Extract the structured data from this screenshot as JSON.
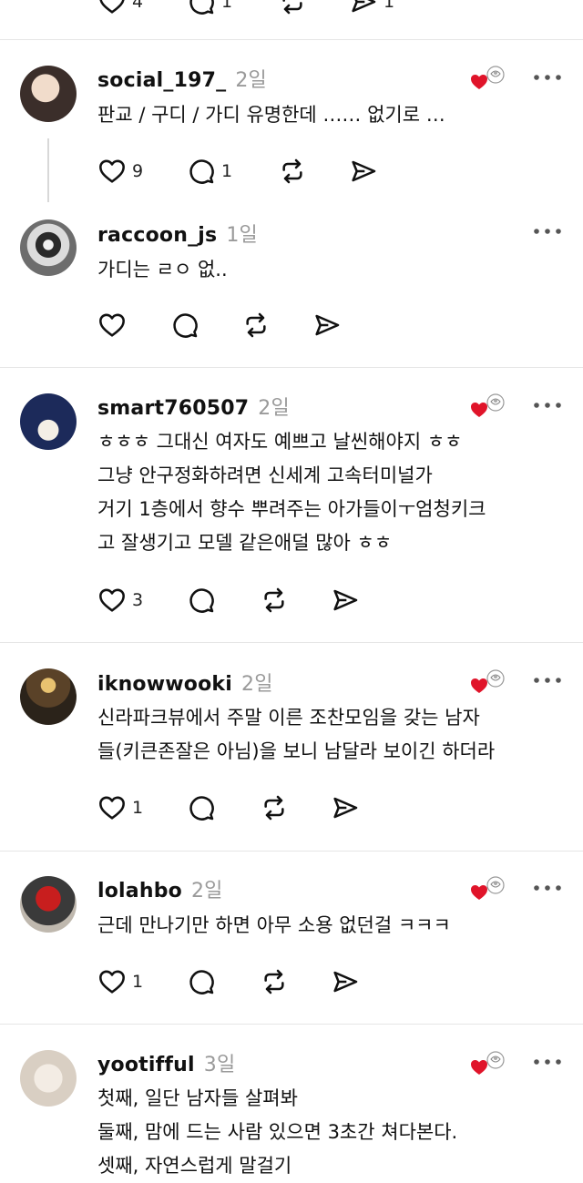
{
  "top_stats": {
    "likes": "4",
    "replies": "1",
    "reposts": "",
    "shares": "1"
  },
  "posts": [
    {
      "username": "social_197_",
      "time": "2일",
      "liked_by_author": true,
      "lines": [
        "판교 / 구디 / 가디 유명한데 …… 없기로 …"
      ],
      "likes": "9",
      "replies": "1"
    },
    {
      "username": "raccoon_js",
      "time": "1일",
      "liked_by_author": false,
      "lines": [
        "가디는 ㄹㅇ 없.."
      ],
      "likes": "",
      "replies": ""
    },
    {
      "username": "smart760507",
      "time": "2일",
      "liked_by_author": true,
      "lines": [
        "ㅎㅎㅎ 그대신 여자도 예쁘고 날씬해야지 ㅎㅎ",
        "그냥 안구정화하려면 신세계 고속터미널가",
        "거기 1층에서 향수 뿌려주는 아가들이ㅜ엄청키크",
        "고 잘생기고 모델 같은애덜 많아 ㅎㅎ"
      ],
      "likes": "3",
      "replies": ""
    },
    {
      "username": "iknowwooki",
      "time": "2일",
      "liked_by_author": true,
      "lines": [
        "신라파크뷰에서 주말 이른 조찬모임을 갖는 남자",
        "들(키큰존잘은 아님)을 보니 남달라 보이긴 하더라"
      ],
      "likes": "1",
      "replies": ""
    },
    {
      "username": "lolahbo",
      "time": "2일",
      "liked_by_author": true,
      "lines": [
        "근데 만나기만 하면 아무 소용 없던걸 ㅋㅋㅋ"
      ],
      "likes": "1",
      "replies": ""
    },
    {
      "username": "yootifful",
      "time": "3일",
      "liked_by_author": true,
      "lines": [
        "첫째, 일단 남자들 살펴봐",
        "둘째, 맘에 드는 사람 있으면 3초간 쳐다본다.",
        "셋째, 자연스럽게 말걸기"
      ],
      "likes": "",
      "replies": ""
    }
  ],
  "colors": {
    "heart": "#e0142a",
    "muted": "#9a9a9a",
    "divider": "#e6e6e6"
  }
}
